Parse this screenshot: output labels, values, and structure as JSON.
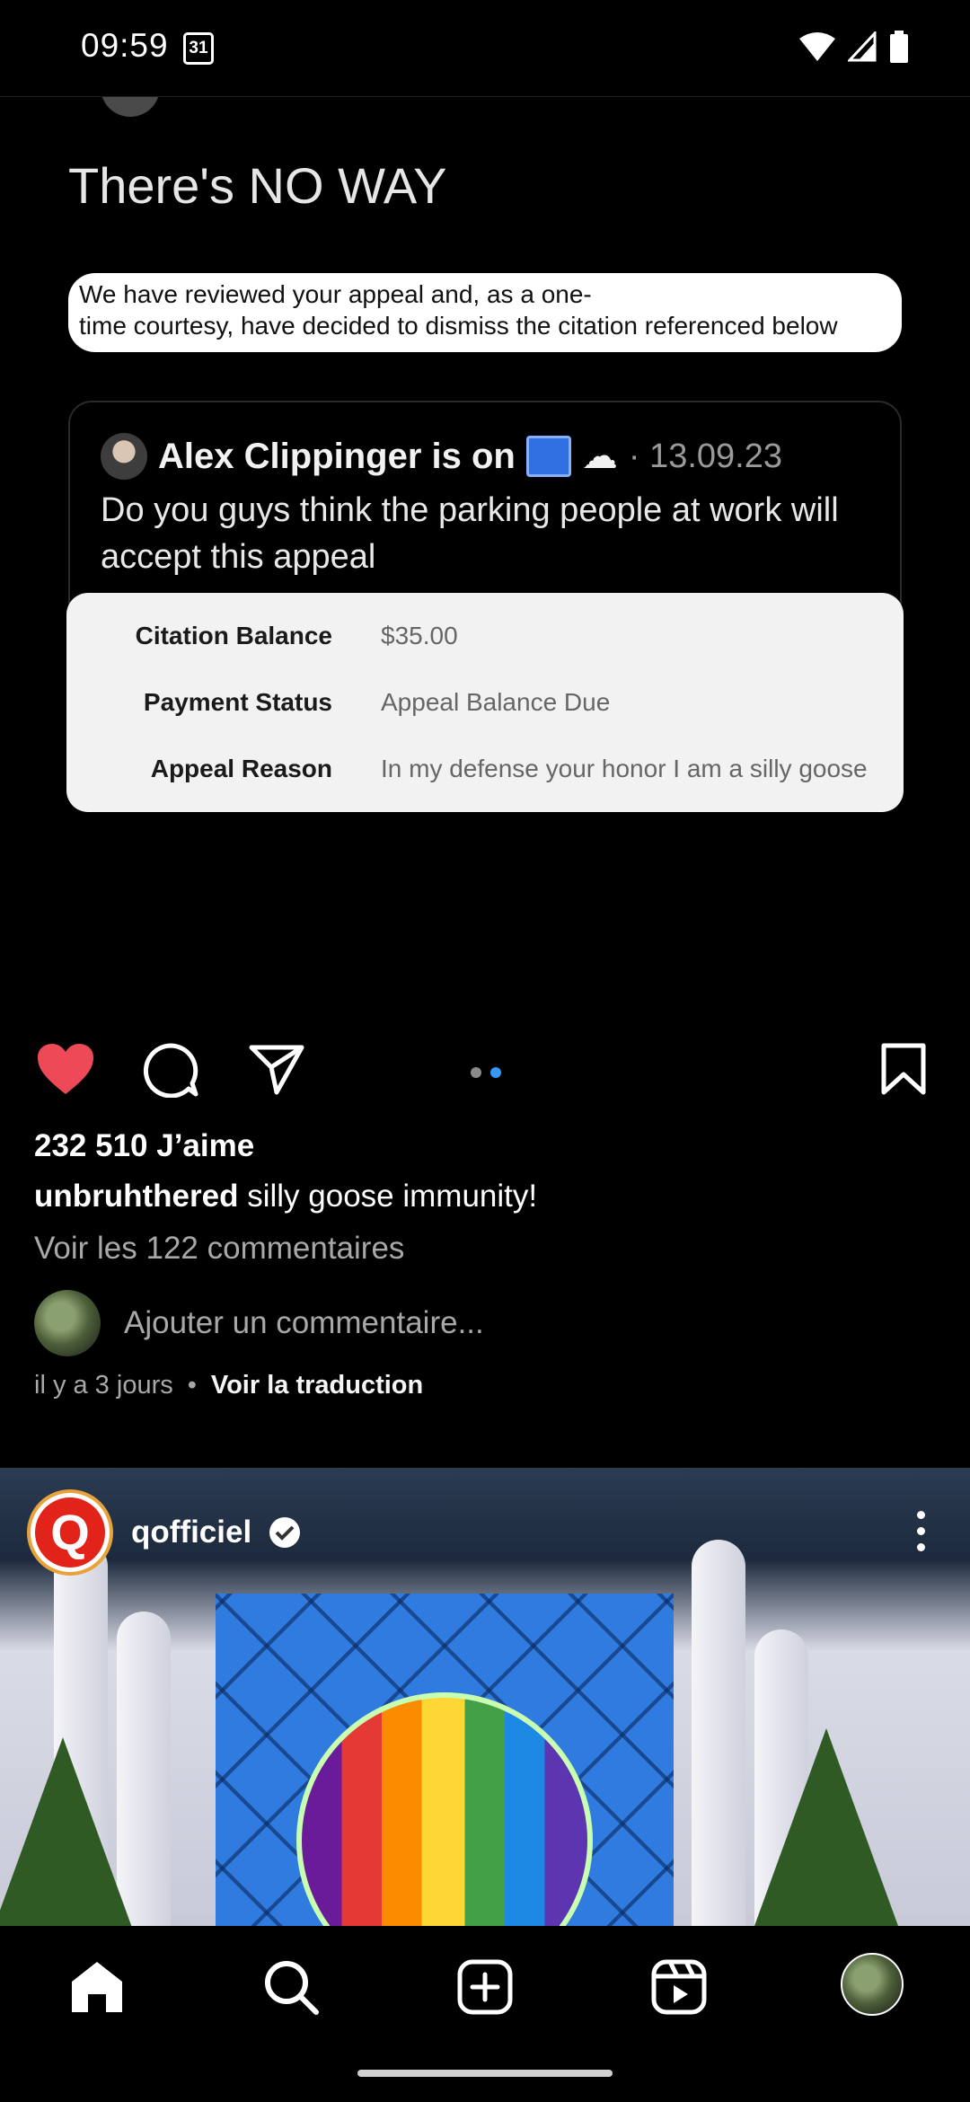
{
  "status_bar": {
    "time": "09:59",
    "calendar_day": "31",
    "icons": [
      "wifi-icon",
      "signal-icon",
      "battery-icon"
    ]
  },
  "post": {
    "headline": "There's NO WAY",
    "notice": {
      "line1": "We have reviewed your appeal and, as a one-",
      "line2": "time courtesy, have decided to dismiss the citation referenced below"
    },
    "tweet": {
      "author": "Alex Clippinger is on",
      "date": "· 13.09.23",
      "text": "Do you guys think the parking people at work will accept this appeal"
    },
    "citation": {
      "rows": [
        {
          "label": "Citation Balance",
          "value": "$35.00"
        },
        {
          "label": "Payment Status",
          "value": "Appeal Balance Due"
        },
        {
          "label": "Appeal Reason",
          "value": "In my defense your honor I am a silly goose"
        }
      ]
    },
    "likes": "232 510 J’aime",
    "caption": {
      "username": "unbruhthered",
      "text": "silly goose immunity!"
    },
    "view_comments": "Voir les 122 commentaires",
    "comment_placeholder": "Ajouter un commentaire...",
    "time_ago": "il y a 3 jours",
    "separator": "•",
    "translate": "Voir la traduction",
    "carousel": {
      "count": 2,
      "active": 2
    }
  },
  "post2": {
    "username": "qofficiel",
    "logo_letter": "Q"
  },
  "nav": {
    "items": [
      "home-icon",
      "search-icon",
      "create-icon",
      "reels-icon",
      "profile-avatar"
    ]
  },
  "colors": {
    "like": "#ed4956",
    "accent": "#3897f0"
  }
}
